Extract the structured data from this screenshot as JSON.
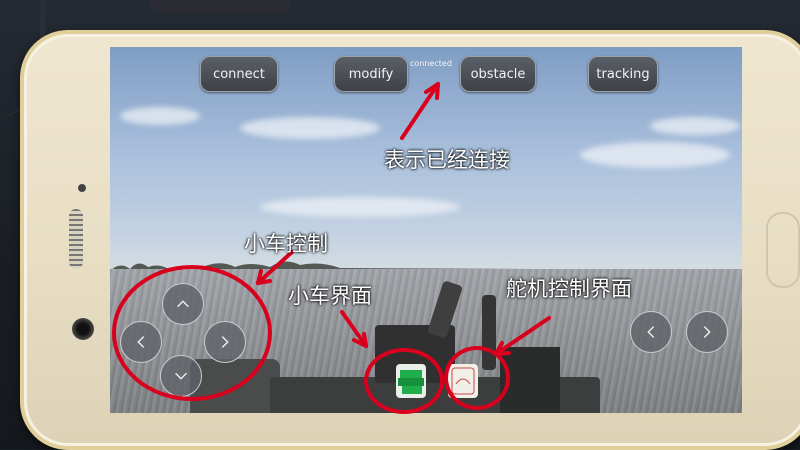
{
  "buttons": {
    "connect": "connect",
    "modify": "modify",
    "obstacle": "obstacle",
    "tracking": "tracking"
  },
  "status_text": "connected",
  "annotations": {
    "connected_note": "表示已经连接",
    "car_control": "小车控制",
    "car_interface": "小车界面",
    "servo_interface": "舵机控制界面"
  },
  "icons": {
    "up": "chevron-up-icon",
    "left": "chevron-left-icon",
    "right": "chevron-right-icon",
    "down": "chevron-down-icon",
    "car_app": "car-interface-icon",
    "servo_app": "servo-interface-icon"
  },
  "colors": {
    "annotation_red": "#d8001d",
    "button_bg": "#4a4e55",
    "car_icon_green": "#1fae4b"
  }
}
